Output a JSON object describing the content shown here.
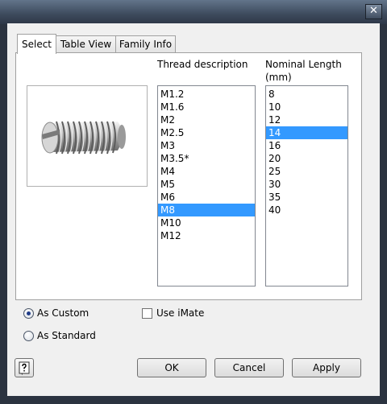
{
  "window": {
    "close_glyph": "✕"
  },
  "tabs": [
    {
      "label": "Select",
      "active": true
    },
    {
      "label": "Table View",
      "active": false
    },
    {
      "label": "Family Info",
      "active": false
    }
  ],
  "thread": {
    "header": "Thread description",
    "items": [
      "M1.2",
      "M1.6",
      "M2",
      "M2.5",
      "M3",
      "M3.5*",
      "M4",
      "M5",
      "M6",
      "M8",
      "M10",
      "M12"
    ],
    "selected": "M8"
  },
  "length": {
    "header_line1": "Nominal Length",
    "header_line2": "(mm)",
    "items": [
      "8",
      "10",
      "12",
      "14",
      "16",
      "20",
      "25",
      "30",
      "35",
      "40"
    ],
    "selected": "14"
  },
  "options": {
    "as_custom": "As Custom",
    "as_standard": "As Standard",
    "use_imate": "Use iMate",
    "selected_mode": "As Custom",
    "use_imate_checked": false
  },
  "buttons": {
    "ok": "OK",
    "cancel": "Cancel",
    "apply": "Apply"
  },
  "icons": {
    "help": "help-icon",
    "preview": "set-screw-preview",
    "close": "close-icon"
  }
}
